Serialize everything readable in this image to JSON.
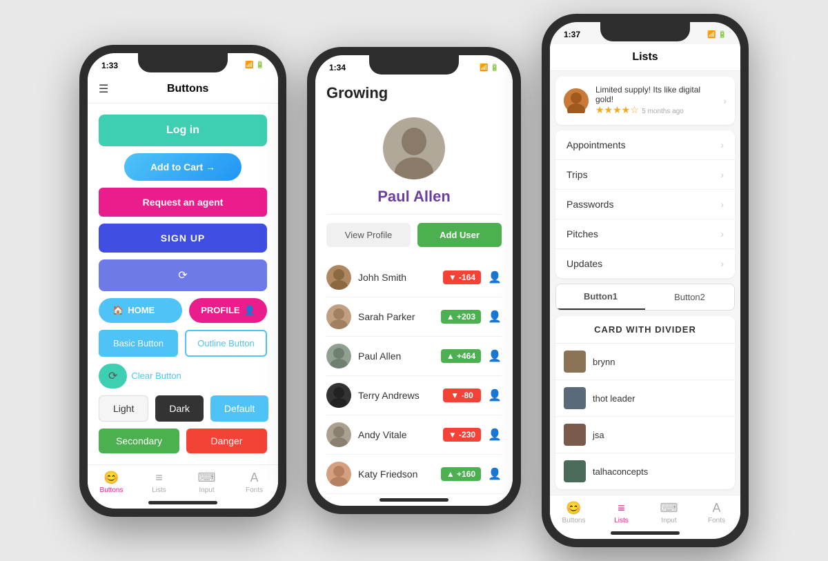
{
  "phone1": {
    "status_time": "1:33",
    "title": "Buttons",
    "buttons": {
      "login": "Log in",
      "add_cart": "Add to Cart →",
      "request": "Request an agent",
      "signup": "SIGN UP",
      "home": "HOME",
      "profile": "PROFILE",
      "basic": "Basic Button",
      "outline": "Outline Button",
      "clear": "Clear Button",
      "light": "Light",
      "dark": "Dark",
      "default": "Default",
      "secondary": "Secondary",
      "danger": "Danger"
    },
    "tabs": [
      {
        "label": "Buttons",
        "icon": "😊",
        "active": true
      },
      {
        "label": "Lists",
        "icon": "≡"
      },
      {
        "label": "Input",
        "icon": "⌨"
      },
      {
        "label": "Fonts",
        "icon": "A"
      }
    ]
  },
  "phone2": {
    "status_time": "1:34",
    "app_title": "Growing",
    "profile_name": "Paul Allen",
    "btn_view_profile": "View Profile",
    "btn_add_user": "Add User",
    "users": [
      {
        "name": "Johh Smith",
        "score": "-164",
        "positive": false
      },
      {
        "name": "Sarah Parker",
        "score": "+203",
        "positive": true
      },
      {
        "name": "Paul Allen",
        "score": "+464",
        "positive": true
      },
      {
        "name": "Terry Andrews",
        "score": "-80",
        "positive": false
      },
      {
        "name": "Andy Vitale",
        "score": "-230",
        "positive": false
      },
      {
        "name": "Katy Friedson",
        "score": "+160",
        "positive": true
      }
    ]
  },
  "phone3": {
    "status_time": "1:37",
    "title": "Lists",
    "review": {
      "text": "Limited supply! Its like digital gold!",
      "stars": "★★★★",
      "empty_star": "☆",
      "time": "5 months ago"
    },
    "list_items": [
      "Appointments",
      "Trips",
      "Passwords",
      "Pitches",
      "Updates"
    ],
    "tab_buttons": [
      "Button1",
      "Button2"
    ],
    "card_title": "CARD WITH DIVIDER",
    "card_users": [
      "brynn",
      "thot leader",
      "jsa",
      "talhaconcepts"
    ],
    "tabs": [
      {
        "label": "Buttons",
        "icon": "😊"
      },
      {
        "label": "Lists",
        "icon": "≡",
        "active": true
      },
      {
        "label": "Input",
        "icon": "⌨"
      },
      {
        "label": "Fonts",
        "icon": "A"
      }
    ]
  }
}
